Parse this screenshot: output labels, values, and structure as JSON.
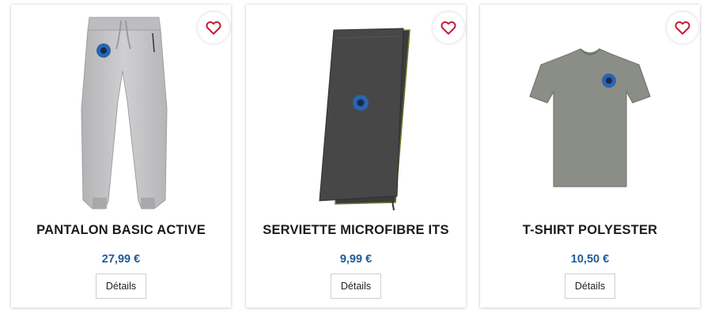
{
  "colors": {
    "heart": "#c8102e",
    "price": "#1f5c99",
    "title": "#1b1b1b"
  },
  "products": [
    {
      "title": "PANTALON BASIC ACTIVE",
      "price": "27,99 €",
      "details_label": "Détails",
      "favorite_icon": "heart-outline-icon",
      "image": "grey jogging pants with blue logo"
    },
    {
      "title": "SERVIETTE MICROFIBRE ITS",
      "price": "9,99 €",
      "details_label": "Détails",
      "favorite_icon": "heart-outline-icon",
      "image": "dark grey microfibre towel with blue logo"
    },
    {
      "title": "T-SHIRT POLYESTER",
      "price": "10,50 €",
      "details_label": "Détails",
      "favorite_icon": "heart-outline-icon",
      "image": "khaki t-shirt with blue logo"
    }
  ]
}
